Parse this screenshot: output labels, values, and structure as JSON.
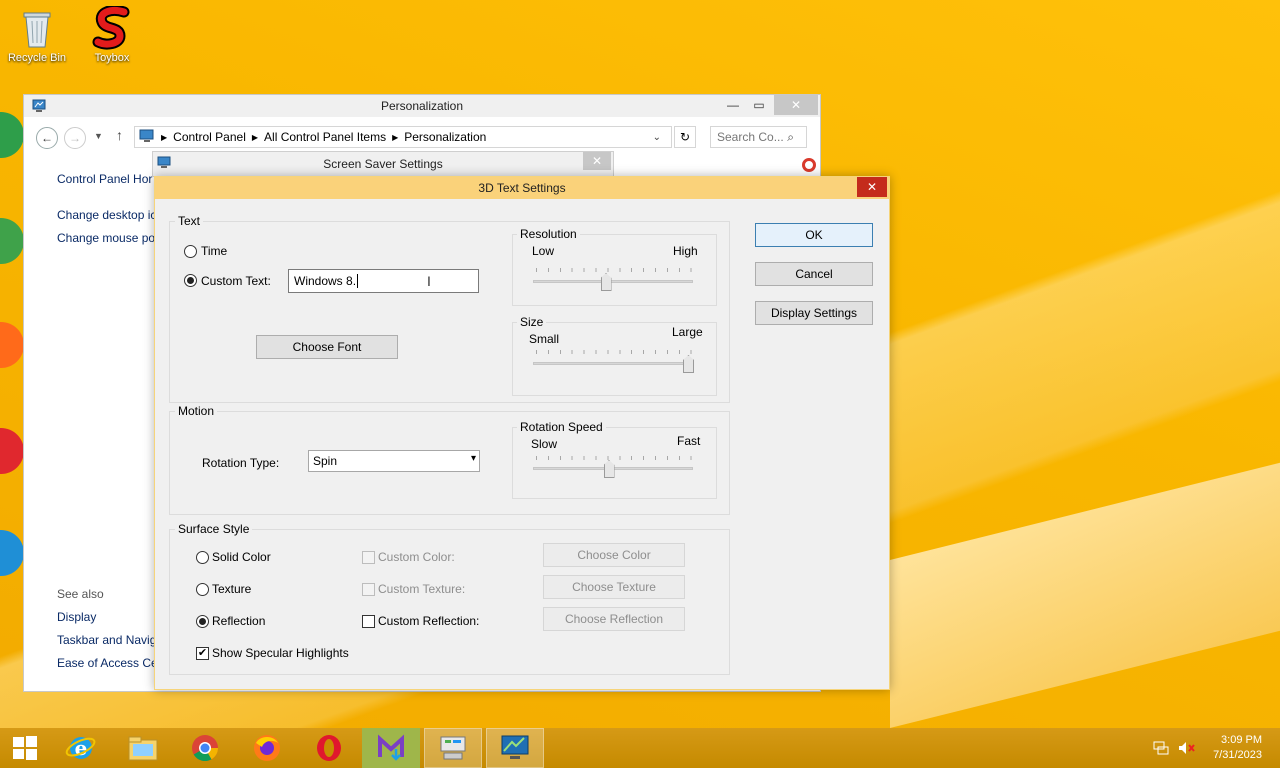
{
  "desktop": {
    "icons": [
      {
        "label": "Recycle Bin"
      },
      {
        "label": "Toybox"
      }
    ]
  },
  "personalization": {
    "title": "Personalization",
    "breadcrumb": [
      "Control Panel",
      "All Control Panel Items",
      "Personalization"
    ],
    "search_placeholder": "Search Co...",
    "sidebar": {
      "home": "Control Panel Hor",
      "links": [
        "Change desktop ic",
        "Change mouse po"
      ],
      "see_also_title": "See also",
      "see_also": [
        "Display",
        "Taskbar and Navig",
        "Ease of Access Cer"
      ]
    }
  },
  "screensaver": {
    "title": "Screen Saver Settings"
  },
  "dialog": {
    "title": "3D Text Settings",
    "text_group": {
      "label": "Text",
      "time_label": "Time",
      "custom_text_label": "Custom Text:",
      "custom_text_value": "Windows 8.",
      "choose_font": "Choose Font",
      "selected": "custom"
    },
    "resolution": {
      "label": "Resolution",
      "low": "Low",
      "high": "High",
      "value": 0.45
    },
    "size": {
      "label": "Size",
      "small": "Small",
      "large": "Large",
      "value": 1.0
    },
    "motion": {
      "label": "Motion",
      "rotation_type_label": "Rotation Type:",
      "rotation_type_value": "Spin"
    },
    "rotation_speed": {
      "label": "Rotation Speed",
      "slow": "Slow",
      "fast": "Fast",
      "value": 0.47
    },
    "surface": {
      "label": "Surface Style",
      "solid_color": "Solid Color",
      "texture": "Texture",
      "reflection": "Reflection",
      "custom_color": "Custom Color:",
      "custom_texture": "Custom Texture:",
      "custom_reflection": "Custom Reflection:",
      "choose_color": "Choose Color",
      "choose_texture": "Choose Texture",
      "choose_reflection": "Choose Reflection",
      "specular": "Show Specular Highlights",
      "selected": "reflection",
      "specular_checked": true
    },
    "buttons": {
      "ok": "OK",
      "cancel": "Cancel",
      "display_settings": "Display Settings"
    }
  },
  "taskbar": {
    "time": "3:09 PM",
    "date": "7/31/2023"
  },
  "colors": {
    "dialog_title": "#fad27a",
    "desktop": "#f4b800",
    "close_red": "#c42b1c"
  }
}
